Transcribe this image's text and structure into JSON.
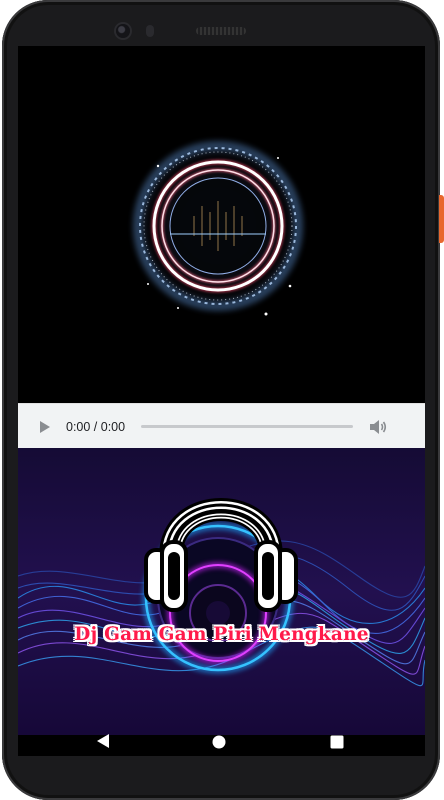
{
  "player": {
    "time_display": "0:00 / 0:00",
    "progress": 0,
    "play_icon": "play-icon",
    "volume_icon": "volume-icon"
  },
  "track": {
    "title": "Dj Gam Gam Piri Mengkane"
  },
  "nav": {
    "back_icon": "back-triangle-icon",
    "home_icon": "home-circle-icon",
    "recent_icon": "recent-square-icon"
  },
  "colors": {
    "title_text": "#ff1a4a",
    "title_outline": "#ffffff",
    "audio_bar_bg": "#f1f3f4",
    "accent_button": "#e8672d"
  }
}
